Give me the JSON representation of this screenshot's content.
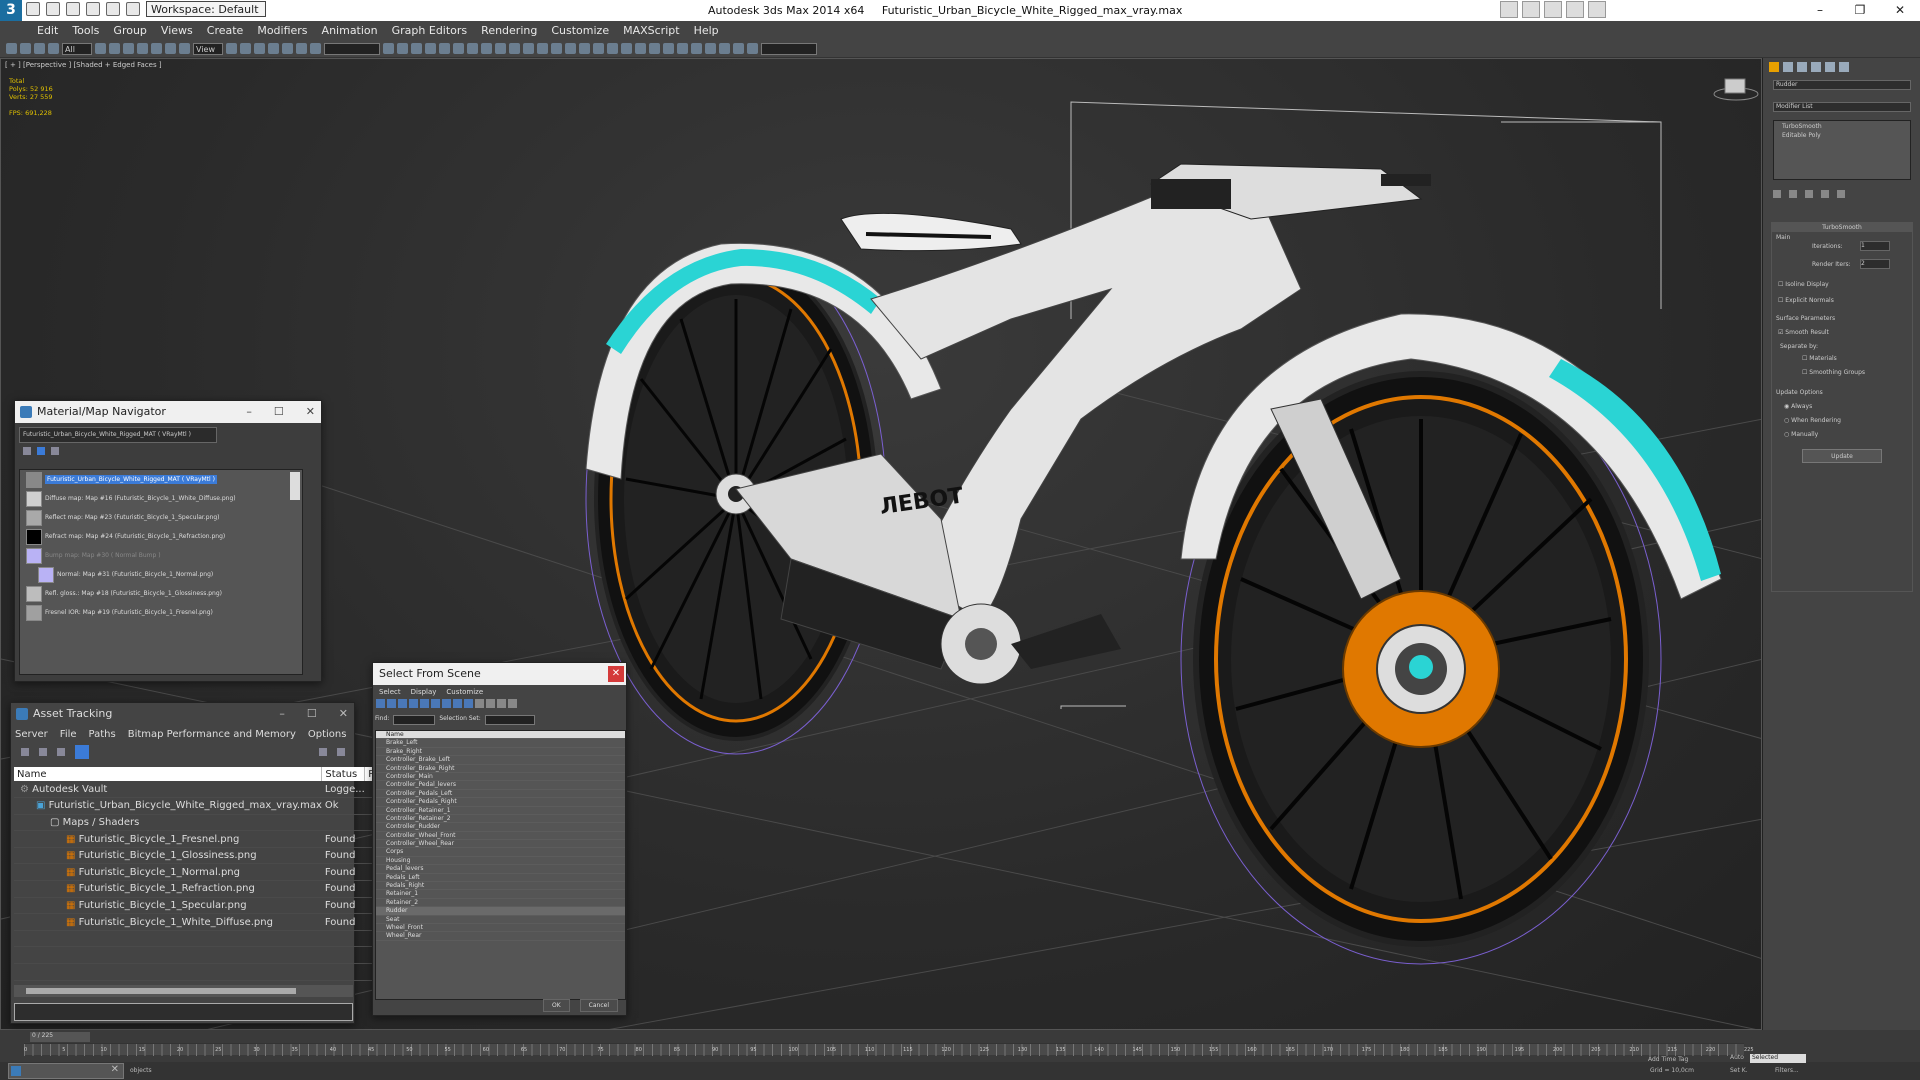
{
  "window": {
    "app_title": "Autodesk 3ds Max  2014 x64",
    "file_title": "Futuristic_Urban_Bicycle_White_Rigged_max_vray.max",
    "workspace": "Workspace: Default"
  },
  "menu": [
    "Edit",
    "Tools",
    "Group",
    "Views",
    "Create",
    "Modifiers",
    "Animation",
    "Graph Editors",
    "Rendering",
    "Customize",
    "MAXScript",
    "Help"
  ],
  "toolbar": {
    "selection_filter": "All",
    "view_mode": "View"
  },
  "viewport": {
    "label": "[ + ] [Perspective ] [Shaded + Edged Faces ]",
    "stats": {
      "total_label": "Total",
      "polys_label": "Polys:",
      "polys": "52 916",
      "verts_label": "Verts:",
      "verts": "27 559",
      "fps_label": "FPS:",
      "fps": "691,228"
    },
    "bike_text": "ЛЕВОТ"
  },
  "material_navigator": {
    "title": "Material/Map Navigator",
    "path": "Futuristic_Urban_Bicycle_White_Rigged_MAT  ( VRayMtl )",
    "items": [
      "Futuristic_Urban_Bicycle_White_Rigged_MAT  ( VRayMtl )",
      "Diffuse map: Map #16 (Futuristic_Bicycle_1_White_Diffuse.png)",
      "Reflect map: Map #23 (Futuristic_Bicycle_1_Specular.png)",
      "Refract map: Map #24 (Futuristic_Bicycle_1_Refraction.png)",
      "Bump map: Map #30 ( Normal Bump )",
      "Normal: Map #31 (Futuristic_Bicycle_1_Normal.png)",
      "Refl. gloss.: Map #18 (Futuristic_Bicycle_1_Glossiness.png)",
      "Fresnel IOR: Map #19 (Futuristic_Bicycle_1_Fresnel.png)"
    ],
    "swatch_colors": [
      "#3a3a3a",
      "#cfcfcf",
      "#a9a9a9",
      "#000000",
      "#b9b2f5",
      "#b9b2f5",
      "#bdbdbd",
      "#a0a0a0"
    ]
  },
  "asset_tracking": {
    "title": "Asset Tracking",
    "menu": [
      "Server",
      "File",
      "Paths",
      "Bitmap Performance and Memory",
      "Options"
    ],
    "columns": [
      "Name",
      "Status",
      "Pro"
    ],
    "rows": [
      {
        "name": "Autodesk Vault",
        "status": "Logge...",
        "indent": 0
      },
      {
        "name": "Futuristic_Urban_Bicycle_White_Rigged_max_vray.max",
        "status": "Ok",
        "indent": 1
      },
      {
        "name": "Maps / Shaders",
        "status": "",
        "indent": 2
      },
      {
        "name": "Futuristic_Bicycle_1_Fresnel.png",
        "status": "Found",
        "indent": 3
      },
      {
        "name": "Futuristic_Bicycle_1_Glossiness.png",
        "status": "Found",
        "indent": 3
      },
      {
        "name": "Futuristic_Bicycle_1_Normal.png",
        "status": "Found",
        "indent": 3
      },
      {
        "name": "Futuristic_Bicycle_1_Refraction.png",
        "status": "Found",
        "indent": 3
      },
      {
        "name": "Futuristic_Bicycle_1_Specular.png",
        "status": "Found",
        "indent": 3
      },
      {
        "name": "Futuristic_Bicycle_1_White_Diffuse.png",
        "status": "Found",
        "indent": 3
      }
    ]
  },
  "select_from_scene": {
    "title": "Select From Scene",
    "menu": [
      "Select",
      "Display",
      "Customize"
    ],
    "find_label": "Find:",
    "selection_set_label": "Selection Set:",
    "column": "Name",
    "items": [
      "Brake_Left",
      "Brake_Right",
      "Controller_Brake_Left",
      "Controller_Brake_Right",
      "Controller_Main",
      "Controller_Pedal_levers",
      "Controller_Pedals_Left",
      "Controller_Pedals_Right",
      "Controller_Retainer_1",
      "Controller_Retainer_2",
      "Controller_Rudder",
      "Controller_Wheel_Front",
      "Controller_Wheel_Rear",
      "Corps",
      "Housing",
      "Pedal_levers",
      "Pedals_Left",
      "Pedals_Right",
      "Retainer_1",
      "Retainer_2",
      "Rudder",
      "Seat",
      "Wheel_Front",
      "Wheel_Rear"
    ],
    "highlighted": "Rudder",
    "ok": "OK",
    "cancel": "Cancel"
  },
  "command_panel": {
    "object_name": "Rudder",
    "modifier_list": "Modifier List",
    "stack": [
      "TurboSmooth",
      "Editable Poly"
    ],
    "rollout": "TurboSmooth",
    "main": "Main",
    "iterations_label": "Iterations:",
    "iterations": "1",
    "render_iters_label": "Render Iters:",
    "render_iters": "2",
    "isoline": "Isoline Display",
    "explicit_normals": "Explicit Normals",
    "surface_params": "Surface Parameters",
    "smooth_result": "Smooth Result",
    "separate_by": "Separate by:",
    "materials": "Materials",
    "smoothing_groups": "Smoothing Groups",
    "update_options": "Update Options",
    "always": "Always",
    "when_rendering": "When Rendering",
    "manually": "Manually",
    "update": "Update"
  },
  "timeline": {
    "frame": "0 / 225",
    "ticks": [
      "0",
      "5",
      "10",
      "15",
      "20",
      "25",
      "30",
      "35",
      "40",
      "45",
      "50",
      "55",
      "60",
      "65",
      "70",
      "75",
      "80",
      "85",
      "90",
      "95",
      "100",
      "105",
      "110",
      "115",
      "120",
      "125",
      "130",
      "135",
      "140",
      "145",
      "150",
      "155",
      "160",
      "165",
      "170",
      "175",
      "180",
      "185",
      "190",
      "195",
      "200",
      "205",
      "210",
      "215",
      "220",
      "225"
    ]
  },
  "status": {
    "selected": "Selected",
    "grid": "Grid = 10,0cm",
    "add_time_tag": "Add Time Tag",
    "objects": "objects",
    "auto": "Auto",
    "set_k": "Set K.",
    "filters": "Filters..."
  },
  "colors": {
    "accent": "#1b6ea0",
    "teal": "#2ad4d4",
    "orange": "#e07800"
  }
}
